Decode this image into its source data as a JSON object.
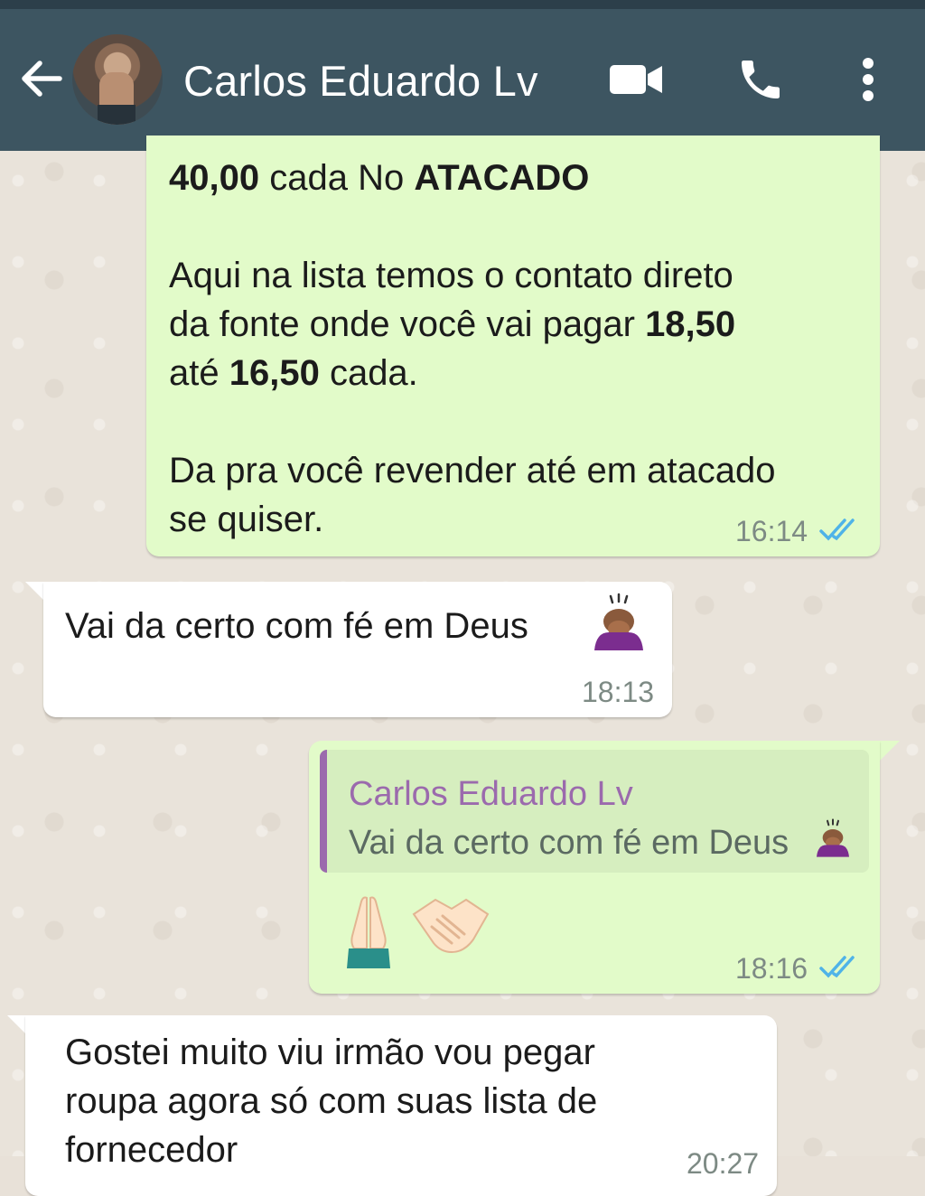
{
  "header": {
    "contact_name": "Carlos Eduardo Lv",
    "back_icon": "arrow-left-icon",
    "video_icon": "video-camera-icon",
    "call_icon": "phone-icon",
    "more_icon": "more-vert-icon"
  },
  "colors": {
    "appbar": "#3d5561",
    "outgoing_bubble": "#e2fbc9",
    "incoming_bubble": "#ffffff",
    "read_ticks": "#4fb3e8",
    "quote_accent": "#9b6aad"
  },
  "messages": [
    {
      "direction": "outgoing",
      "lines": [
        {
          "bold_a": "40,00",
          "text_a": " cada No ",
          "bold_b": "ATACADO"
        },
        {
          "text": "Aqui na lista temos o contato direto"
        },
        {
          "text_a": "da fonte onde você vai pagar ",
          "bold_a": "18,50"
        },
        {
          "text_a": "até ",
          "bold_a": "16,50",
          "text_b": " cada."
        },
        {
          "text": "Da pra você revender até em atacado"
        },
        {
          "text": "se quiser."
        }
      ],
      "time": "16:14",
      "status": "read"
    },
    {
      "direction": "incoming",
      "text": "Vai da certo com fé em Deus",
      "emoji": "person-bowing-icon",
      "time": "18:13"
    },
    {
      "direction": "outgoing",
      "quote": {
        "author": "Carlos Eduardo Lv",
        "text": "Vai da certo com fé em Deus",
        "emoji": "person-bowing-icon"
      },
      "emojis": [
        "folded-hands-icon",
        "handshake-icon"
      ],
      "time": "18:16",
      "status": "read"
    },
    {
      "direction": "incoming",
      "lines": [
        "Gostei muito viu irmão vou pegar",
        "roupa agora só com suas lista de",
        "fornecedor"
      ],
      "time": "20:27"
    }
  ]
}
